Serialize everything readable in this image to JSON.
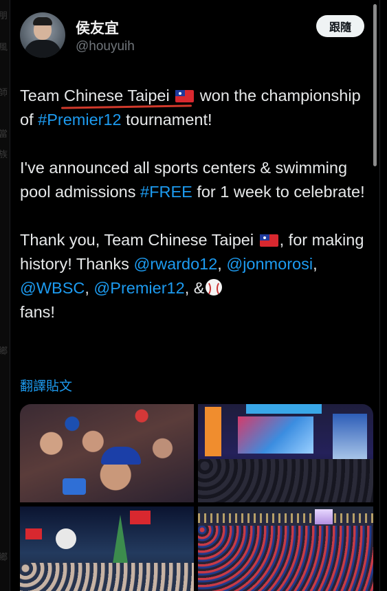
{
  "user": {
    "display_name": "侯友宜",
    "handle": "@houyuih"
  },
  "actions": {
    "follow_label": "跟隨"
  },
  "tweet": {
    "p1": {
      "t1": "Team ",
      "t2": "Chinese Taipei",
      "t3": " won the championship of ",
      "tag": "#Premier12",
      "t4": " tournament!"
    },
    "p2": {
      "t1": "I've announced all sports centers & swimming pool admissions ",
      "tag": "#FREE",
      "t2": " for 1 week to celebrate!"
    },
    "p3": {
      "t1": "Thank you, Team Chinese Taipei ",
      "t2": ", for making history! Thanks ",
      "m1": "@rwardo12",
      "c1": ", ",
      "m2": "@jonmorosi",
      "c2": ", ",
      "m3": "@WBSC",
      "c3": ", ",
      "m4": "@Premier12",
      "t3": ", &",
      "t4": " fans!"
    }
  },
  "translate_label": "翻譯貼文",
  "icons": {
    "flag": "taiwan-flag-icon",
    "baseball": "baseball-icon"
  },
  "colors": {
    "background": "#000000",
    "text": "#e7e9ea",
    "link": "#1d9bf0",
    "muted": "#71767b",
    "follow_button": "#eff3f4",
    "annotation_underline": "#d0392b"
  }
}
